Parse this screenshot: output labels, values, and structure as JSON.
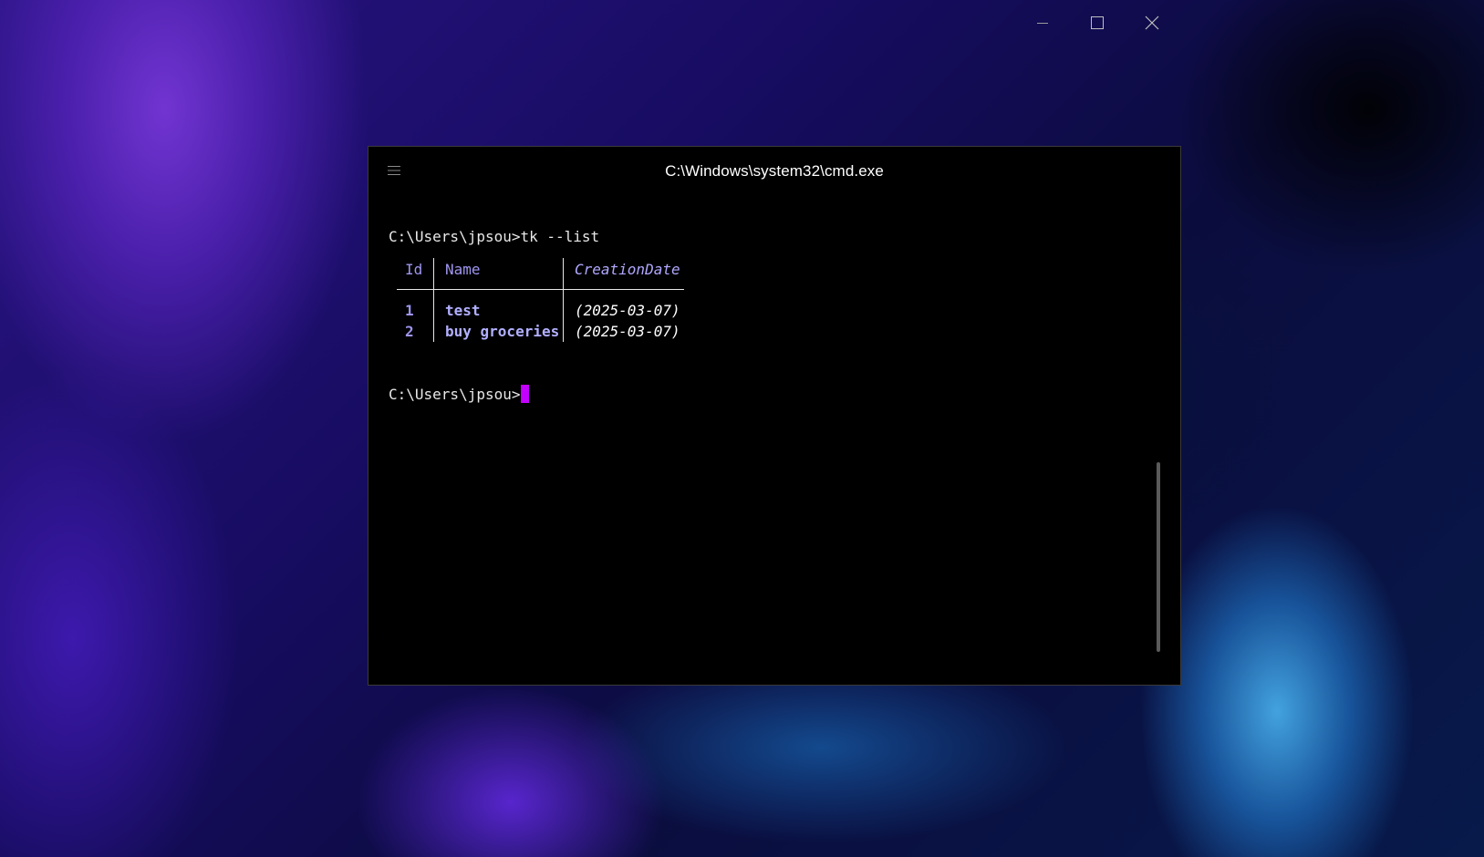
{
  "window": {
    "title": "C:\\Windows\\system32\\cmd.exe",
    "menu_icon": "hamburger-menu-icon",
    "controls": {
      "minimize_icon": "minimize-icon",
      "maximize_icon": "maximize-icon",
      "close_icon": "close-icon"
    }
  },
  "terminal": {
    "command_line": "C:\\Users\\jpsou>tk --list",
    "prompt": "C:\\Users\\jpsou>",
    "cursor_color": "#c400ff",
    "table": {
      "headers": [
        "Id",
        "Name",
        "CreationDate"
      ],
      "rows": [
        {
          "id": "1",
          "name": "test",
          "date": "(2025-03-07)"
        },
        {
          "id": "2",
          "name": "buy groceries",
          "date": "(2025-03-07)"
        }
      ]
    }
  },
  "colors": {
    "terminal_bg": "#000000",
    "accent_purple": "#9f96f0",
    "cursor": "#c400ff"
  }
}
